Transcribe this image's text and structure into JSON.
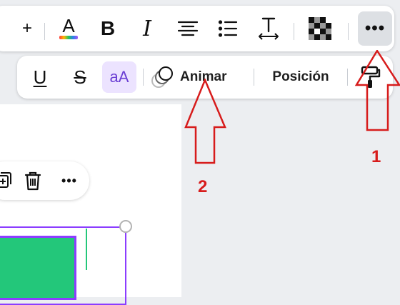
{
  "toolbar": {
    "plus_label": "+",
    "text_color_letter": "A",
    "bold_letter": "B",
    "italic_letter": "I",
    "more_label": "•••"
  },
  "format_bar": {
    "underline_letter": "U",
    "strikethrough_letter": "S",
    "case_label": "aA",
    "animate_label": "Animar",
    "position_label": "Posición"
  },
  "context_bar": {
    "more_label": "•••"
  },
  "annotations": [
    {
      "label": "1",
      "color": "#d71c1c"
    },
    {
      "label": "2",
      "color": "#d71c1c"
    }
  ],
  "colors": {
    "accent_purple": "#8b3dff",
    "shape_green": "#23c77a",
    "annotation_red": "#d71c1c"
  }
}
